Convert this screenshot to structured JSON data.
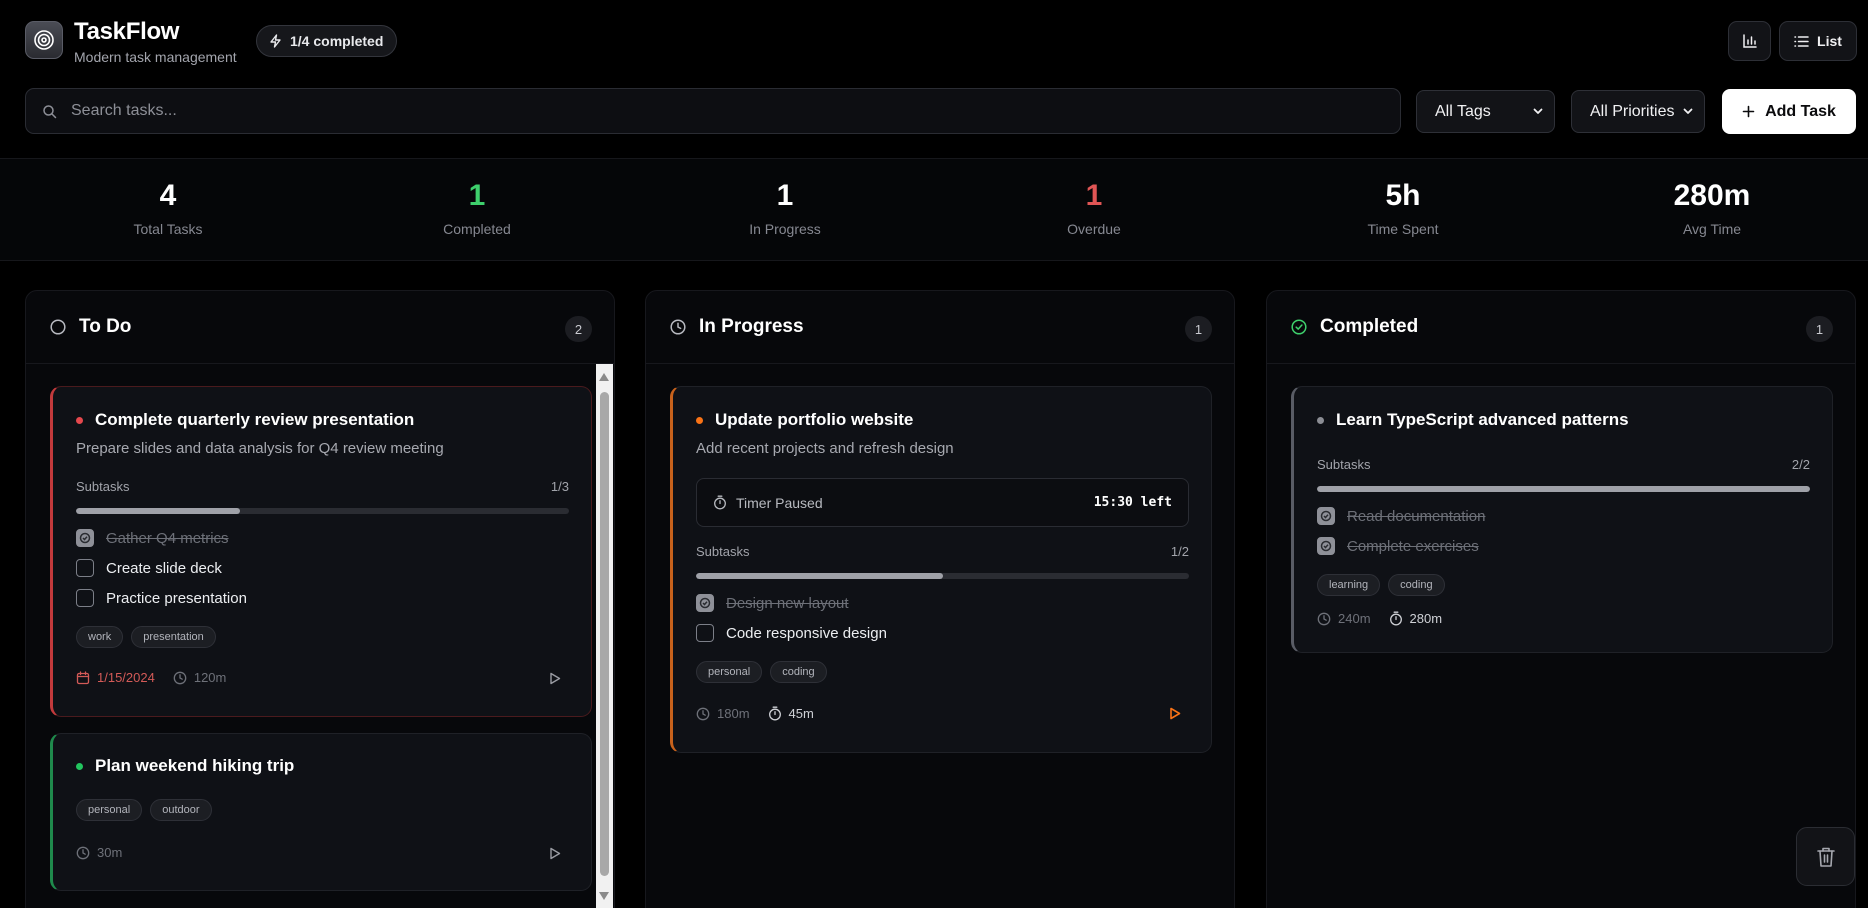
{
  "app": {
    "title": "TaskFlow",
    "subtitle": "Modern task management",
    "progress": "1/4 completed"
  },
  "header": {
    "list_label": "List",
    "chart_icon": "bar-chart-icon",
    "list_icon": "list-icon"
  },
  "toolbar": {
    "search_placeholder": "Search tasks...",
    "tags_filter": "All Tags",
    "priority_filter": "All Priorities",
    "add_label": "Add Task"
  },
  "stats": [
    {
      "value": "4",
      "label": "Total Tasks",
      "color": "#ffffff"
    },
    {
      "value": "1",
      "label": "Completed",
      "color": "#3ecf6c"
    },
    {
      "value": "1",
      "label": "In Progress",
      "color": "#ffffff"
    },
    {
      "value": "1",
      "label": "Overdue",
      "color": "#e05555"
    },
    {
      "value": "5h",
      "label": "Time Spent",
      "color": "#ffffff"
    },
    {
      "value": "280m",
      "label": "Avg Time",
      "color": "#ffffff"
    }
  ],
  "columns": [
    {
      "title": "To Do",
      "count": "2",
      "cards": [
        {
          "title": "Complete quarterly review presentation",
          "description": "Prepare slides and data analysis for Q4 review meeting",
          "priority_color": "#e5484d",
          "subtasks_label": "Subtasks",
          "subtasks_count": "1/3",
          "subtasks_progress": 0.333,
          "subtasks": [
            {
              "label": "Gather Q4 metrics",
              "done": true
            },
            {
              "label": "Create slide deck",
              "done": false
            },
            {
              "label": "Practice presentation",
              "done": false
            }
          ],
          "tags": [
            "work",
            "presentation"
          ],
          "due": "1/15/2024",
          "estimate": "120m"
        },
        {
          "title": "Plan weekend hiking trip",
          "priority_color": "#22c55e",
          "tags": [
            "personal",
            "outdoor"
          ],
          "estimate": "30m"
        }
      ]
    },
    {
      "title": "In Progress",
      "count": "1",
      "cards": [
        {
          "title": "Update portfolio website",
          "description": "Add recent projects and refresh design",
          "priority_color": "#f97316",
          "timer_status": "Timer Paused",
          "timer_left": "15:30 left",
          "subtasks_label": "Subtasks",
          "subtasks_count": "1/2",
          "subtasks_progress": 0.5,
          "subtasks": [
            {
              "label": "Design new layout",
              "done": true
            },
            {
              "label": "Code responsive design",
              "done": false
            }
          ],
          "tags": [
            "personal",
            "coding"
          ],
          "estimate": "180m",
          "spent": "45m"
        }
      ]
    },
    {
      "title": "Completed",
      "count": "1",
      "cards": [
        {
          "title": "Learn TypeScript advanced patterns",
          "priority_color": "#8b8d94",
          "subtasks_label": "Subtasks",
          "subtasks_count": "2/2",
          "subtasks_progress": 1.0,
          "subtasks": [
            {
              "label": "Read documentation",
              "done": true
            },
            {
              "label": "Complete exercises",
              "done": true
            }
          ],
          "tags": [
            "learning",
            "coding"
          ],
          "estimate": "240m",
          "spent": "280m"
        }
      ]
    }
  ]
}
